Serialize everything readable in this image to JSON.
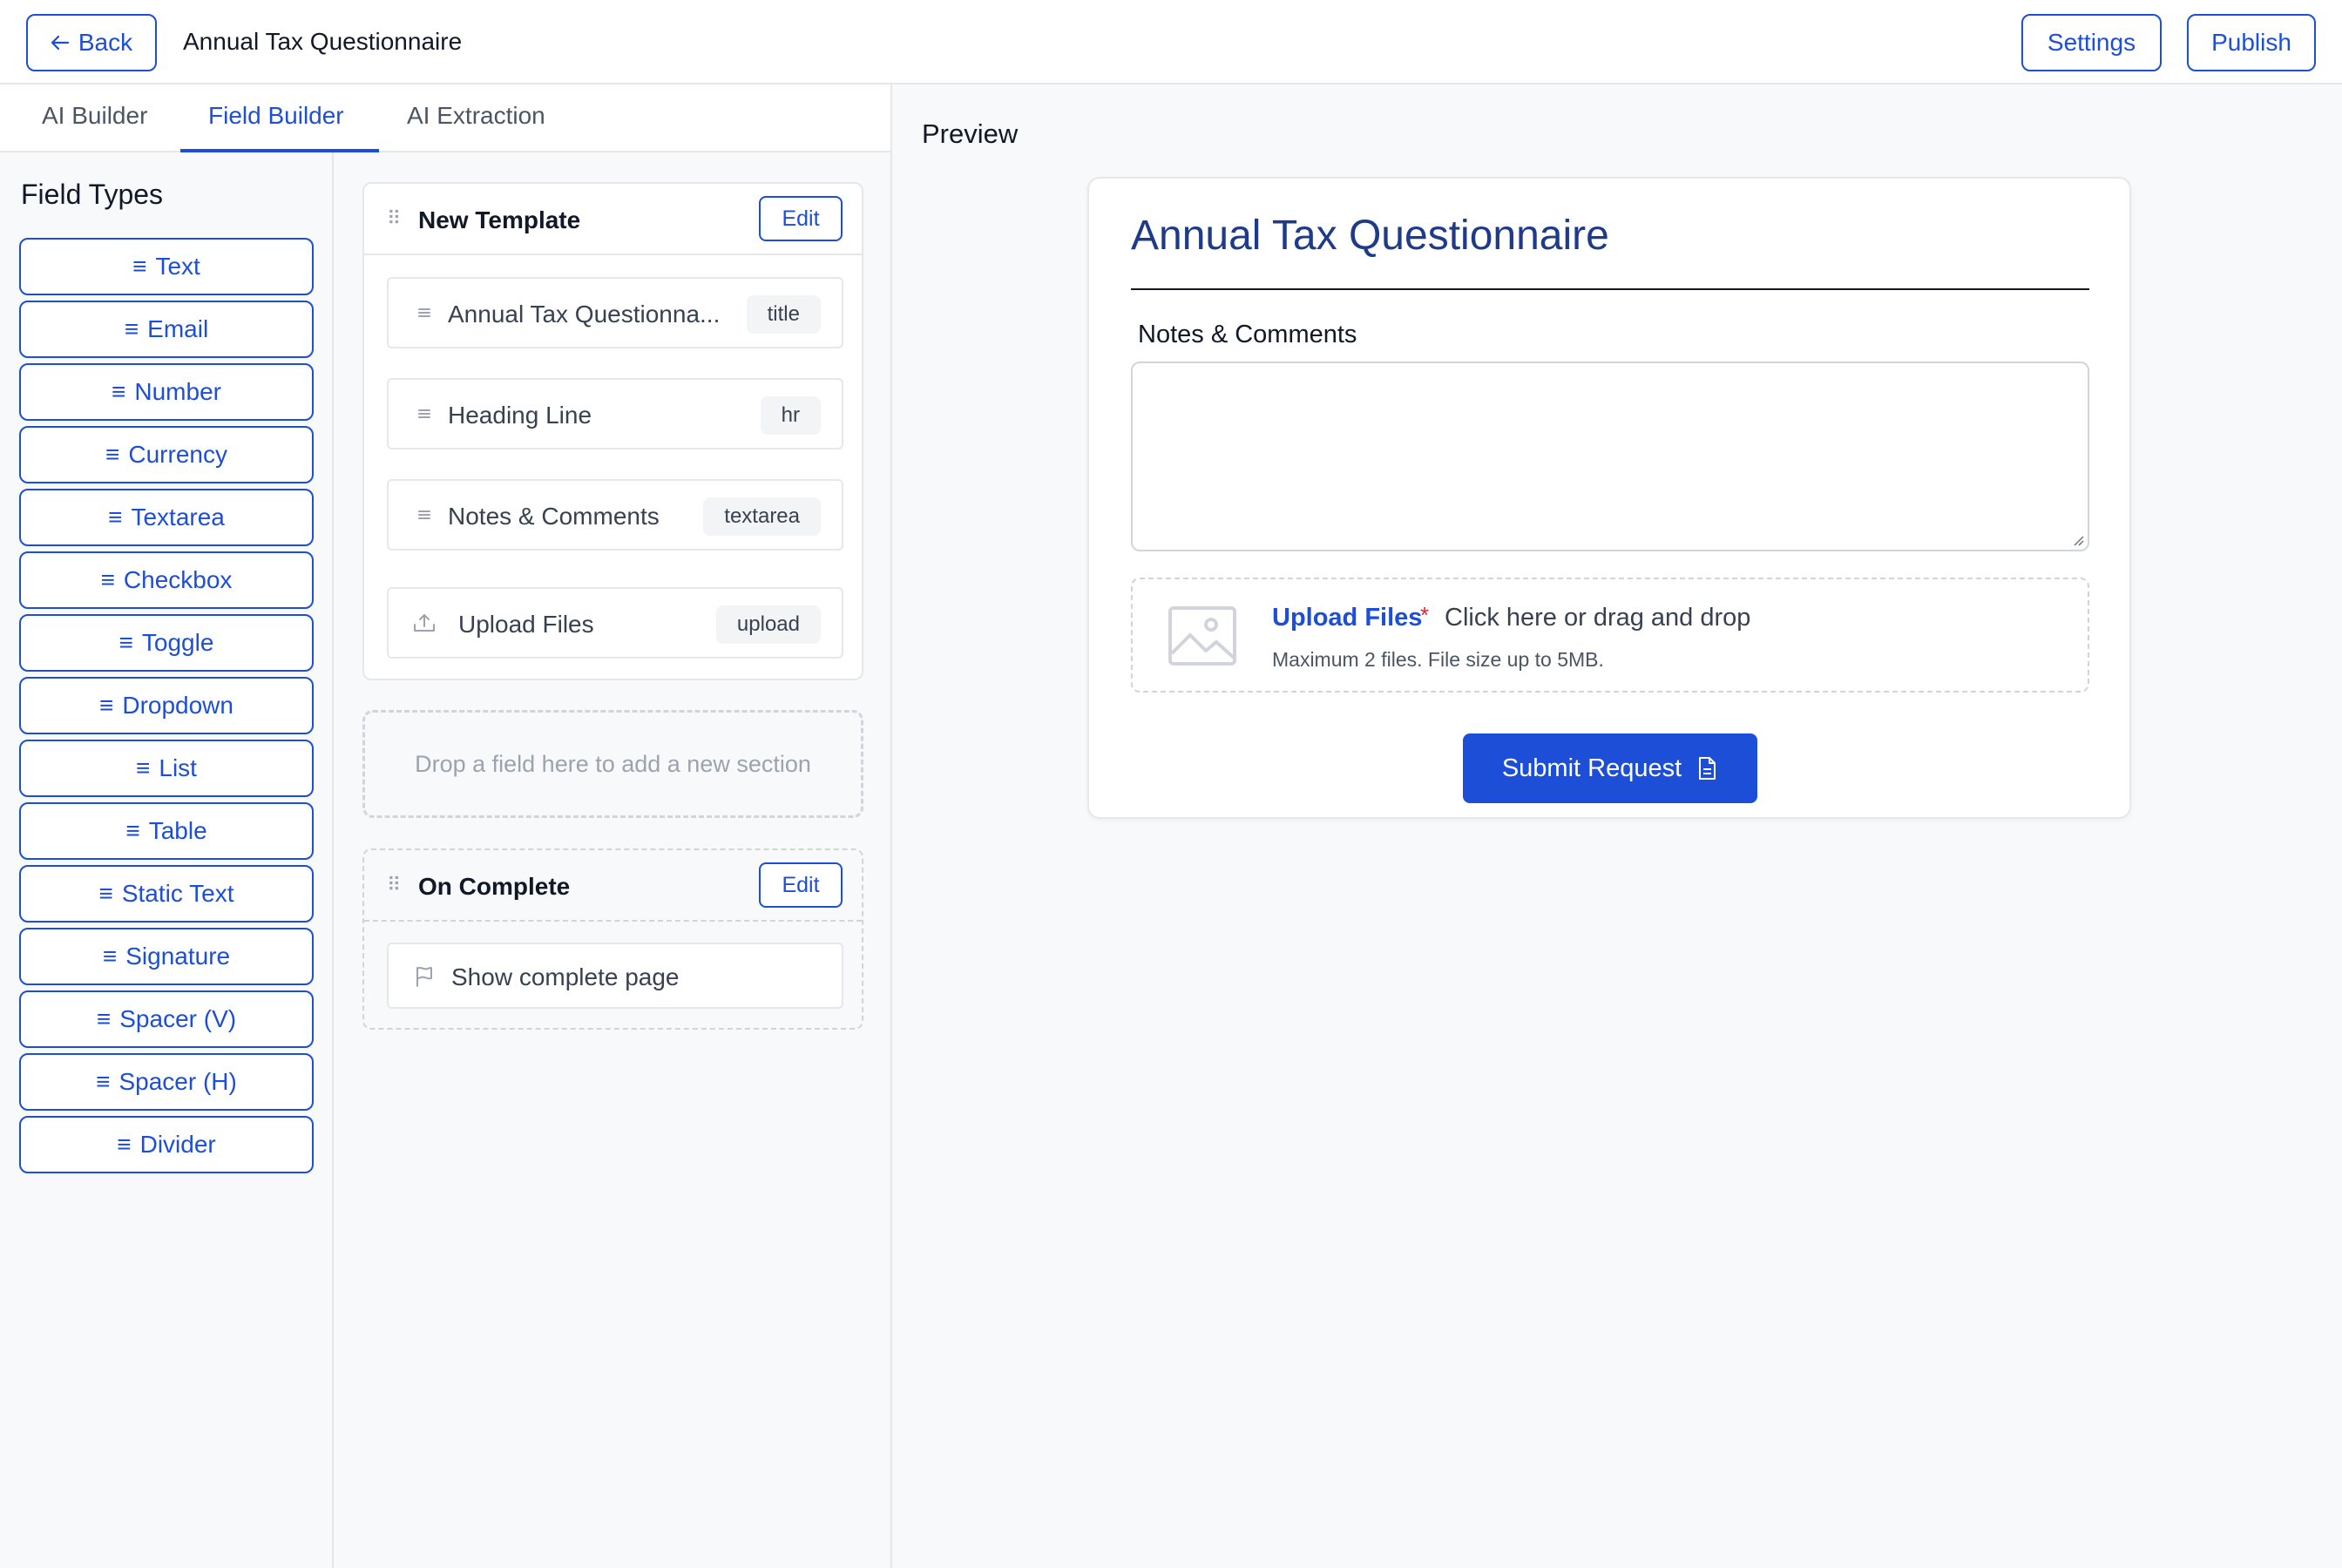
{
  "header": {
    "back_label": "Back",
    "title": "Annual Tax Questionnaire",
    "settings_label": "Settings",
    "publish_label": "Publish"
  },
  "tabs": [
    {
      "label": "AI Builder",
      "active": false
    },
    {
      "label": "Field Builder",
      "active": true
    },
    {
      "label": "AI Extraction",
      "active": false
    }
  ],
  "field_types": {
    "title": "Field Types",
    "items": [
      {
        "label": "Text",
        "icon": "drag-lines-icon"
      },
      {
        "label": "Email",
        "icon": "drag-lines-icon"
      },
      {
        "label": "Number",
        "icon": "drag-lines-icon"
      },
      {
        "label": "Currency",
        "icon": "drag-lines-icon"
      },
      {
        "label": "Textarea",
        "icon": "drag-lines-icon"
      },
      {
        "label": "Checkbox",
        "icon": "drag-lines-icon"
      },
      {
        "label": "Toggle",
        "icon": "drag-lines-icon"
      },
      {
        "label": "Dropdown",
        "icon": "drag-lines-icon"
      },
      {
        "label": "List",
        "icon": "drag-lines-icon"
      },
      {
        "label": "Table",
        "icon": "drag-lines-icon"
      },
      {
        "label": "Static Text",
        "icon": "drag-lines-icon"
      },
      {
        "label": "Signature",
        "icon": "drag-lines-icon"
      },
      {
        "label": "Spacer (V)",
        "icon": "drag-lines-icon"
      },
      {
        "label": "Spacer (H)",
        "icon": "drag-lines-icon"
      },
      {
        "label": "Divider",
        "icon": "drag-lines-icon"
      }
    ]
  },
  "builder": {
    "template_section": {
      "title": "New Template",
      "edit_label": "Edit",
      "fields": [
        {
          "label": "Annual Tax Questionna...",
          "tag": "title",
          "icon": "drag-lines-icon"
        },
        {
          "label": "Heading Line",
          "tag": "hr",
          "icon": "drag-lines-icon"
        },
        {
          "label": "Notes & Comments",
          "tag": "textarea",
          "icon": "drag-lines-icon"
        },
        {
          "label": "Upload Files",
          "tag": "upload",
          "icon": "upload-icon"
        }
      ]
    },
    "drop_zone_text": "Drop a field here to add a new section",
    "complete_section": {
      "title": "On Complete",
      "edit_label": "Edit",
      "action_label": "Show complete page",
      "action_icon": "flag-icon"
    }
  },
  "preview": {
    "label": "Preview",
    "form_title": "Annual Tax Questionnaire",
    "notes_label": "Notes & Comments",
    "notes_value": "",
    "upload": {
      "link_label": "Upload Files",
      "required_mark": "*",
      "hint": "Click here or drag and drop",
      "sub": "Maximum 2 files.  File size up to 5MB."
    },
    "submit_label": "Submit Request"
  },
  "colors": {
    "accent": "#1d4ed8",
    "title_blue": "#1e3a8a",
    "required": "#dc2626",
    "border": "#e5e7eb",
    "background": "#f8f9fb"
  }
}
